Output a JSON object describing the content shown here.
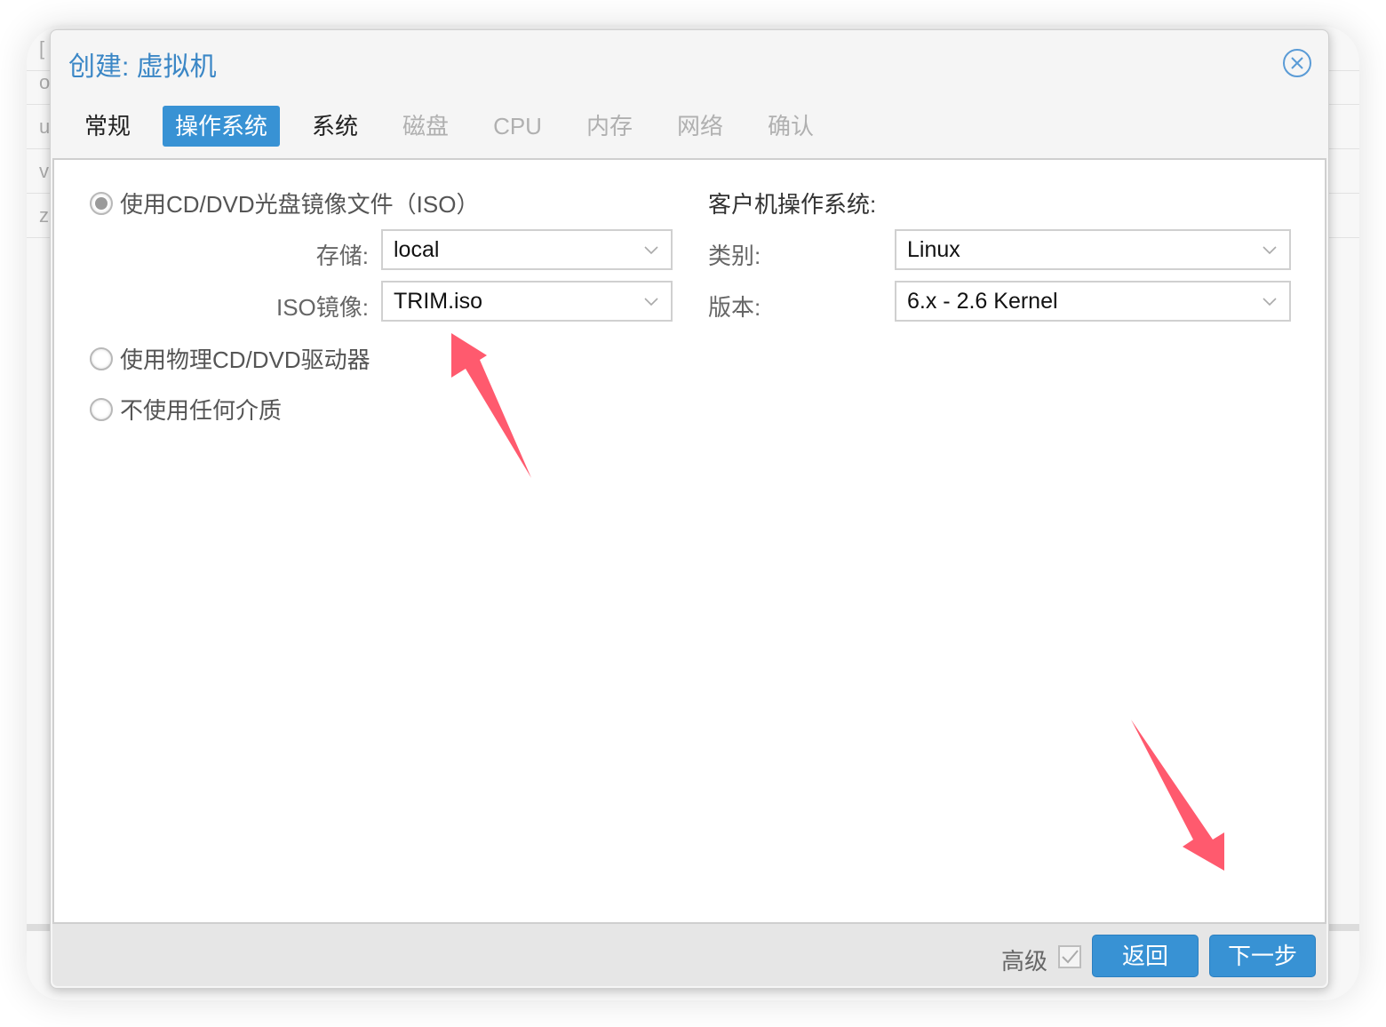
{
  "background": {
    "rows": [
      "[",
      "o",
      "u",
      "v",
      "z"
    ]
  },
  "dialog": {
    "title": "创建: 虚拟机",
    "close_icon": "close-circle-icon",
    "tabs": [
      {
        "label": "常规",
        "state": "normal"
      },
      {
        "label": "操作系统",
        "state": "active"
      },
      {
        "label": "系统",
        "state": "normal"
      },
      {
        "label": "磁盘",
        "state": "disabled"
      },
      {
        "label": "CPU",
        "state": "disabled"
      },
      {
        "label": "内存",
        "state": "disabled"
      },
      {
        "label": "网络",
        "state": "disabled"
      },
      {
        "label": "确认",
        "state": "disabled"
      }
    ]
  },
  "media": {
    "options": [
      {
        "label": "使用CD/DVD光盘镜像文件（ISO）",
        "checked": true
      },
      {
        "label": "使用物理CD/DVD驱动器",
        "checked": false
      },
      {
        "label": "不使用任何介质",
        "checked": false
      }
    ],
    "storage_label": "存储:",
    "storage_value": "local",
    "iso_label": "ISO镜像:",
    "iso_value": "TRIM.iso"
  },
  "guest_os": {
    "title": "客户机操作系统:",
    "type_label": "类别:",
    "type_value": "Linux",
    "version_label": "版本:",
    "version_value": "6.x - 2.6 Kernel"
  },
  "footer": {
    "advanced_label": "高级",
    "advanced_checked": true,
    "back_label": "返回",
    "next_label": "下一步"
  },
  "annotations": {
    "arrow_color": "#ff5a6e",
    "accent_color": "#3892d4"
  }
}
